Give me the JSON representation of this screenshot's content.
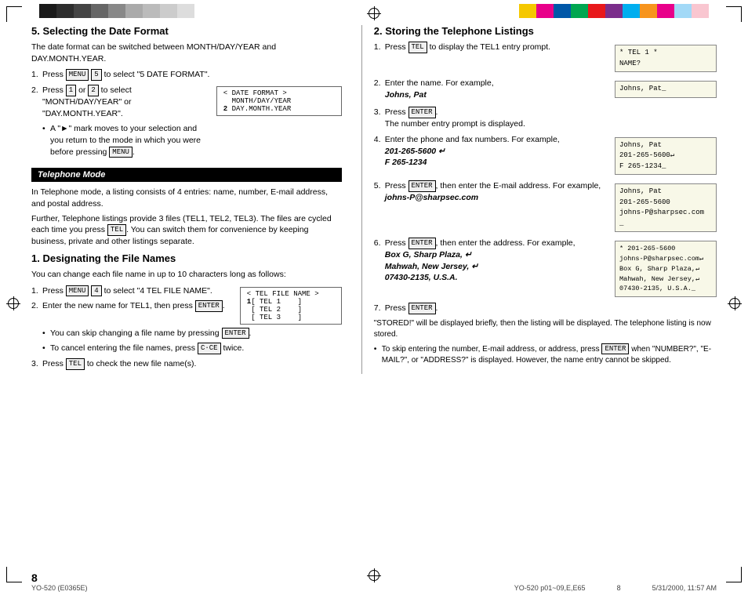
{
  "topBar": {
    "colorsLeft": [
      "#1a1a1a",
      "#2d2d2d",
      "#444",
      "#666",
      "#888",
      "#aaa",
      "#bbb",
      "#ccc",
      "#ddd"
    ],
    "colorsRight": [
      "#f5c800",
      "#e8008a",
      "#0057a8",
      "#00a650",
      "#e8181b",
      "#7b2d8b",
      "#00aeef",
      "#f7941d",
      "#e8008a",
      "#a2d9f7",
      "#f9c6d0"
    ]
  },
  "sections": {
    "left": {
      "section5": {
        "heading": "5. Selecting the Date Format",
        "intro": "The date format can be switched between MONTH/DAY/YEAR and DAY.MONTH.YEAR.",
        "steps": [
          "Press [MENU] 5 to select \"5 DATE FORMAT\".",
          "Press 1 or 2 to select \"MONTH/DAY/YEAR\" or \"DAY.MONTH.YEAR\".",
          "A \"►\" mark moves to your selection and you return to the mode in which you were before pressing [MENU]."
        ],
        "formatBox": {
          "line1": "< DATE FORMAT >",
          "line2": "  MONTH/DAY/YEAR",
          "line3": "2 DAY.MONTH.YEAR"
        }
      },
      "telMode": {
        "heading": "Telephone Mode",
        "para1": "In Telephone mode, a listing consists of 4 entries: name, number, E-mail address, and postal address.",
        "para2": "Further, Telephone listings provide 3 files (TEL1, TEL2, TEL3). The files are cycled each time you press [TEL]. You can switch them for convenience by keeping business, private and other listings separate."
      },
      "section1": {
        "heading": "1. Designating the File Names",
        "intro": "You can change each file name in up to 10 characters long as follows:",
        "steps": [
          "Press [MENU] 4 to select \"4 TEL FILE NAME\".",
          "Enter the new name for TEL1, then press [ENTER].",
          "You can skip changing a file name by pressing [ENTER].",
          "To cancel entering the file names, press [C·CE] twice.",
          "Press [TEL] to check the new file name(s)."
        ],
        "fileNameBox": {
          "line1": "< TEL FILE NAME >",
          "line2": "1[ TEL 1    ]",
          "line3": "[ TEL 2    ]",
          "line4": "[ TEL 3    ]"
        }
      }
    },
    "right": {
      "section2": {
        "heading": "2. Storing the Telephone Listings",
        "steps": [
          {
            "num": "1.",
            "text": "Press [TEL] to display the TEL1 entry prompt."
          },
          {
            "num": "2.",
            "text": "Enter the name. For example,"
          },
          {
            "num": "3.",
            "text": "Press [ENTER].",
            "note": "The number entry prompt is displayed."
          },
          {
            "num": "4.",
            "text": "Enter the phone and fax numbers. For example,"
          },
          {
            "num": "5.",
            "text": "Press [ENTER], then enter the E-mail address. For example,"
          },
          {
            "num": "6.",
            "text": "Press [ENTER], then enter the address. For example,"
          },
          {
            "num": "7.",
            "text": "Press [ENTER]."
          }
        ],
        "examples": {
          "name": "Johns, Pat",
          "phoneLabel": "201-265-5600 ↵",
          "faxLabel": "F   265-1234",
          "email": "johns-P@sharpsec.com",
          "address1": "Box G, Sharp Plaza, ↵",
          "address2": "Mahwah, New Jersey, ↵",
          "address3": "07430-2135, U.S.A."
        },
        "lcd1": {
          "line1": "*  TEL 1  *",
          "line2": "NAME?"
        },
        "lcd2": {
          "line1": "Johns, Pat_"
        },
        "lcd3": {
          "line1": "Johns, Pat",
          "line2": "201-265-5600↵",
          "line3": "F   265-1234_"
        },
        "lcd4": {
          "line1": "Johns, Pat",
          "line2": "201-265-5600",
          "line3": "johns-P@sharpsec.com",
          "line4": "_"
        },
        "lcd5": {
          "line1": "* 201-265-5600",
          "line2": "johns-P@sharpsec.com↵",
          "line3": "Box G, Sharp Plaza,↵",
          "line4": "Mahwah, New Jersey,↵",
          "line5": "07430-2135, U.S.A._"
        },
        "storedNote": "\"STORED!\" will be displayed briefly, then the listing will be displayed. The telephone listing is now stored.",
        "skipNote": "To skip entering the number, E-mail address, or address, press [ENTER] when \"NUMBER?\", \"E-MAIL?\", or \"ADDRESS?\" is displayed. However, the name entry cannot be skipped."
      }
    }
  },
  "footer": {
    "pageNum": "8",
    "leftInfo": "YO-520 p01~09,E,E65",
    "centerInfo": "8",
    "rightInfo": "5/31/2000, 11:57 AM",
    "modelLeft": "YO-520 (E0365E)"
  }
}
